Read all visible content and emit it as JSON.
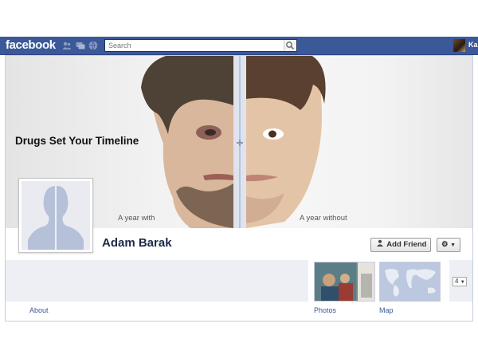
{
  "header": {
    "logo": "facebook",
    "search_placeholder": "Search",
    "user_name": "Ka",
    "icons": [
      "friend-requests-icon",
      "messages-icon",
      "notifications-icon",
      "search-icon"
    ]
  },
  "cover": {
    "title": "Drugs Set Your Timeline",
    "caption_left": "A year with",
    "caption_right": "A year without"
  },
  "profile": {
    "name": "Adam Barak",
    "add_friend_label": "Add Friend",
    "gear_icon": "gear-icon"
  },
  "sections": {
    "about": "About",
    "photos": "Photos",
    "map": "Map",
    "more_count": "4"
  },
  "colors": {
    "brand": "#3b5998",
    "name": "#1c2a47",
    "panel": "#edeff4"
  }
}
